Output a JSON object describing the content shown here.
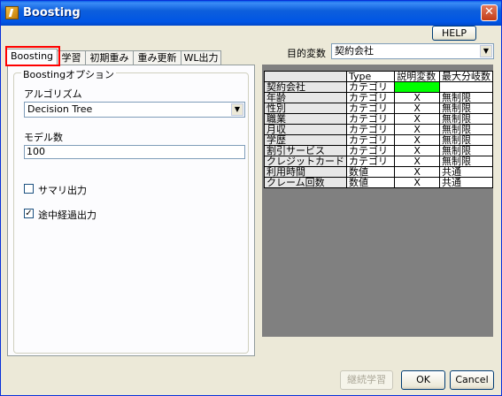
{
  "window": {
    "title": "Boosting",
    "close_label": "✕"
  },
  "header": {
    "help_label": "HELP",
    "target_label": "目的変数",
    "target_value": "契約会社"
  },
  "tabs": [
    "Boosting",
    "学習",
    "初期重み",
    "重み更新",
    "WL出力"
  ],
  "options": {
    "group_title": "Boostingオプション",
    "algorithm_label": "アルゴリズム",
    "algorithm_value": "Decision Tree",
    "model_count_label": "モデル数",
    "model_count_value": "100",
    "summary_label": "サマリ出力",
    "summary_checked": false,
    "progress_label": "途中経過出力",
    "progress_checked": true,
    "check_mark": "✓"
  },
  "grid": {
    "headers": [
      "",
      "Type",
      "説明変数",
      "最大分岐数"
    ],
    "rows": [
      {
        "name": "契約会社",
        "type": "カテゴリ",
        "explanatory": "",
        "max_branch": "",
        "is_target": true
      },
      {
        "name": "年齢",
        "type": "カテゴリ",
        "explanatory": "X",
        "max_branch": "無制限"
      },
      {
        "name": "性別",
        "type": "カテゴリ",
        "explanatory": "X",
        "max_branch": "無制限"
      },
      {
        "name": "職業",
        "type": "カテゴリ",
        "explanatory": "X",
        "max_branch": "無制限"
      },
      {
        "name": "月収",
        "type": "カテゴリ",
        "explanatory": "X",
        "max_branch": "無制限"
      },
      {
        "name": "学歴",
        "type": "カテゴリ",
        "explanatory": "X",
        "max_branch": "無制限"
      },
      {
        "name": "割引サービス",
        "type": "カテゴリ",
        "explanatory": "X",
        "max_branch": "無制限"
      },
      {
        "name": "クレジットカード",
        "type": "カテゴリ",
        "explanatory": "X",
        "max_branch": "無制限"
      },
      {
        "name": "利用時間",
        "type": "数値",
        "explanatory": "X",
        "max_branch": "共通"
      },
      {
        "name": "クレーム回数",
        "type": "数値",
        "explanatory": "X",
        "max_branch": "共通"
      }
    ],
    "target_color": "#00ff00"
  },
  "footer": {
    "relearn_label": "継続学習",
    "ok_label": "OK",
    "cancel_label": "Cancel"
  }
}
